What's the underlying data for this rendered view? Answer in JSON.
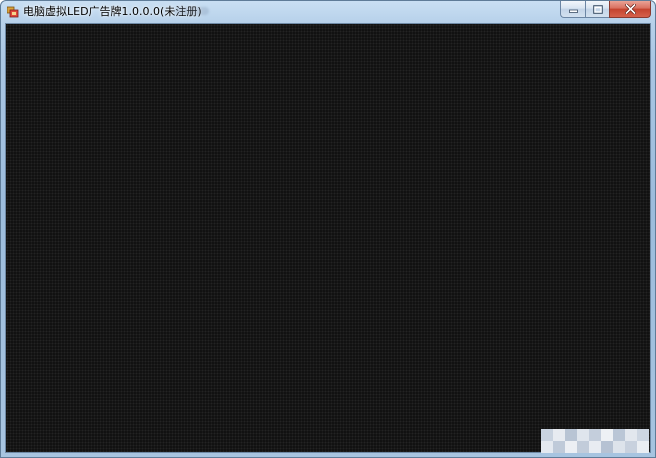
{
  "window": {
    "title": "电脑虚拟LED广告牌1.0.0.0(未注册)",
    "icon": "app-icon",
    "caption_buttons": {
      "minimize_icon": "minimize-icon",
      "maximize_icon": "maximize-icon",
      "close_icon": "close-icon"
    }
  },
  "display": {
    "background_color": "#0f0f0f",
    "dot_color": "#232323"
  },
  "colors": {
    "frame": "#a9c6e3",
    "close_button": "#c4432e"
  }
}
